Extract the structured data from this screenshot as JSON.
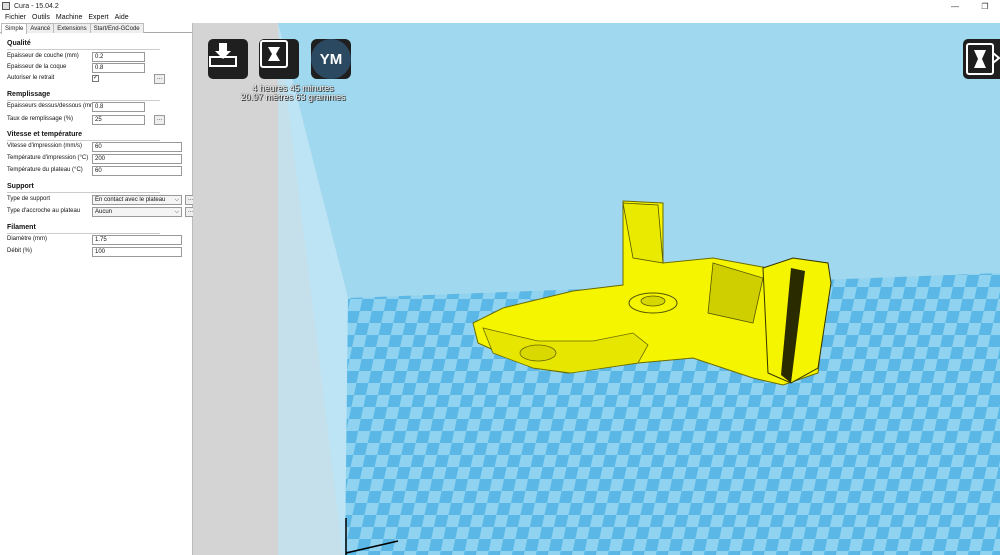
{
  "window": {
    "title": "Cura - 15.04.2",
    "minimize": "—",
    "restore": "❐"
  },
  "menu": [
    "Fichier",
    "Outils",
    "Machine",
    "Expert",
    "Aide"
  ],
  "tabs": [
    "Simple",
    "Avancé",
    "Extensions",
    "Start/End-GCode"
  ],
  "sections": {
    "qualite": {
      "title": "Qualité",
      "layer_height_label": "Epaisseur de couche (mm)",
      "layer_height_value": "0.2",
      "shell_label": "Epaisseur de la coque",
      "shell_value": "0.8",
      "retract_label": "Autoriser le retrait",
      "retract_checked": "✓"
    },
    "remplissage": {
      "title": "Remplissage",
      "top_bottom_label": "Epaisseurs dessus/dessous (mm)",
      "top_bottom_value": "0.8",
      "fill_label": "Taux de remplissage (%)",
      "fill_value": "25"
    },
    "vitesse": {
      "title": "Vitesse et température",
      "speed_label": "Vitesse d'impression (mm/s)",
      "speed_value": "60",
      "print_temp_label": "Température d'impression (°C)",
      "print_temp_value": "200",
      "bed_temp_label": "Température du plateau (°C)",
      "bed_temp_value": "60"
    },
    "support": {
      "title": "Support",
      "type_label": "Type de support",
      "type_value": "En contact avec le plateau",
      "adhesion_label": "Type d'accroche au plateau",
      "adhesion_value": "Aucun"
    },
    "filament": {
      "title": "Filament",
      "diameter_label": "Diamètre (mm)",
      "diameter_value": "1.75",
      "flow_label": "Débit (%)",
      "flow_value": "100"
    }
  },
  "dots_label": "...",
  "viewport": {
    "print_time": "4 heures 45 minutes",
    "print_material": "20.97 mètres 63 grammes",
    "ym_label": "YM"
  },
  "colors": {
    "model": "#f5f500",
    "bed_light": "#8fd3f0",
    "bed_dark": "#5bb8e6",
    "wall": "#9fd8ef"
  }
}
